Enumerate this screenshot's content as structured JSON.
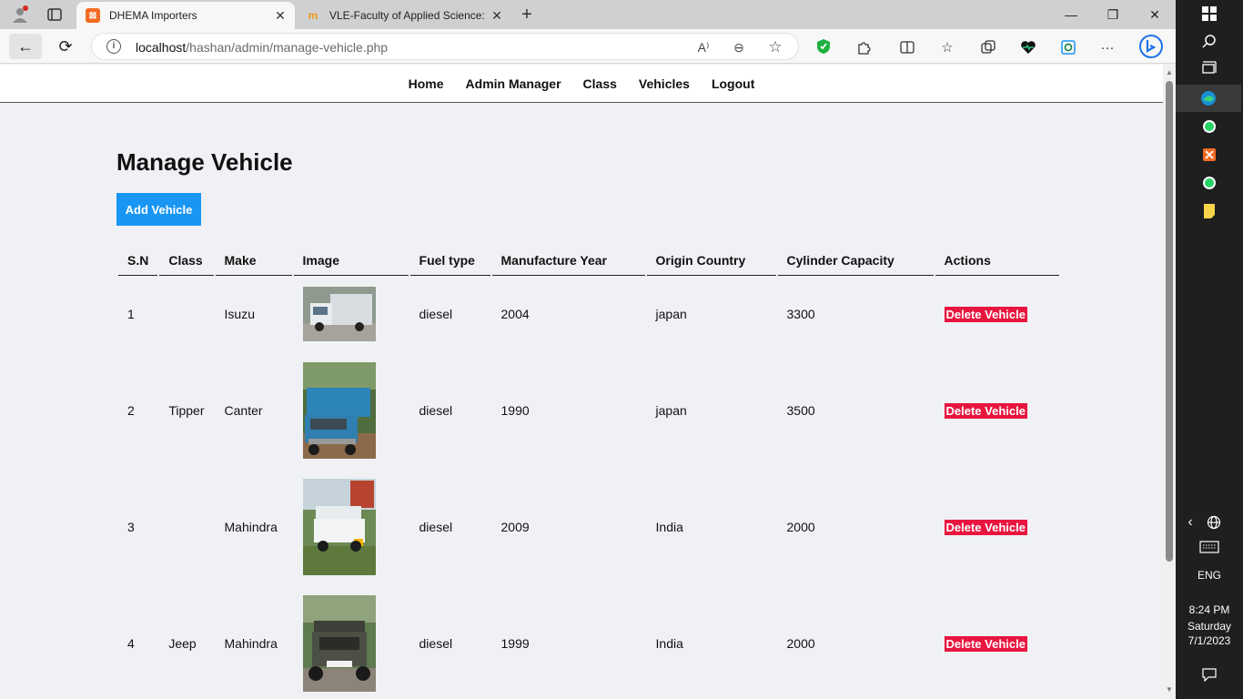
{
  "browser": {
    "tabs": [
      {
        "title": "DHEMA Importers",
        "active": true
      },
      {
        "title": "VLE-Faculty of Applied Science: L",
        "active": false
      }
    ],
    "url": {
      "host": "localhost",
      "path": "/hashan/admin/manage-vehicle.php"
    },
    "icons": {
      "profile": "profile-avatar-icon",
      "tab_actions": "tab-actions-icon",
      "new_tab": "+",
      "minimize": "—",
      "maximize": "❐",
      "close": "✕",
      "back": "←",
      "refresh": "⟳",
      "read_aloud": "A⁾",
      "zoom": "⊖",
      "favorite": "☆",
      "more": "···"
    }
  },
  "nav": {
    "items": [
      "Home",
      "Admin Manager",
      "Class",
      "Vehicles",
      "Logout"
    ]
  },
  "page": {
    "title": "Manage Vehicle",
    "add_button": "Add Vehicle"
  },
  "table": {
    "headers": [
      "S.N",
      "Class",
      "Make",
      "Image",
      "Fuel type",
      "Manufacture Year",
      "Origin Country",
      "Cylinder Capacity",
      "Actions"
    ],
    "rows": [
      {
        "sn": "1",
        "class": "",
        "make": "Isuzu",
        "fuel": "diesel",
        "year": "2004",
        "country": "japan",
        "capacity": "3300",
        "action": "Delete Vehicle"
      },
      {
        "sn": "2",
        "class": "Tipper",
        "make": "Canter",
        "fuel": "diesel",
        "year": "1990",
        "country": "japan",
        "capacity": "3500",
        "action": "Delete Vehicle"
      },
      {
        "sn": "3",
        "class": "",
        "make": "Mahindra",
        "fuel": "diesel",
        "year": "2009",
        "country": "India",
        "capacity": "2000",
        "action": "Delete Vehicle"
      },
      {
        "sn": "4",
        "class": "Jeep",
        "make": "Mahindra",
        "fuel": "diesel",
        "year": "1999",
        "country": "India",
        "capacity": "2000",
        "action": "Delete Vehicle"
      }
    ]
  },
  "taskbar": {
    "lang": "ENG",
    "time": "8:24 PM",
    "day": "Saturday",
    "date": "7/1/2023"
  },
  "colors": {
    "accent": "#1995f3",
    "danger": "#e8163f",
    "page_bg": "#f0f1f5"
  }
}
